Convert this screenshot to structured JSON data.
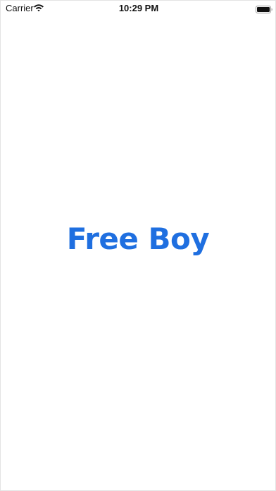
{
  "status_bar": {
    "carrier": "Carrier",
    "time": "10:29 PM",
    "wifi_icon": "wifi-icon",
    "battery_icon": "battery-icon"
  },
  "splash": {
    "logo_text": "Free Boy",
    "brand_color": "#1f6fe0"
  }
}
